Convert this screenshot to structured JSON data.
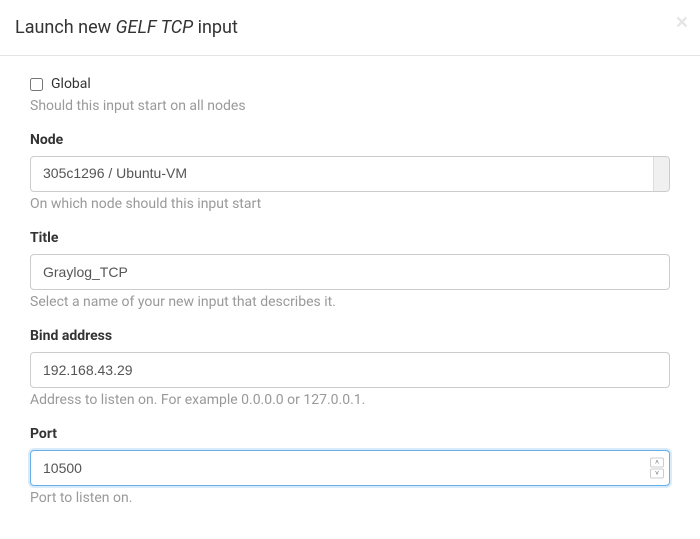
{
  "header": {
    "title_prefix": "Launch new ",
    "title_em": "GELF TCP",
    "title_suffix": " input",
    "close": "×"
  },
  "form": {
    "global": {
      "label": "Global",
      "help": "Should this input start on all nodes"
    },
    "node": {
      "label": "Node",
      "value": "305c1296 / Ubuntu-VM",
      "help": "On which node should this input start"
    },
    "title": {
      "label": "Title",
      "value": "Graylog_TCP",
      "help": "Select a name of your new input that describes it."
    },
    "bind_address": {
      "label": "Bind address",
      "value": "192.168.43.29",
      "help": "Address to listen on. For example 0.0.0.0 or 127.0.0.1."
    },
    "port": {
      "label": "Port",
      "value": "10500",
      "help": "Port to listen on."
    }
  }
}
